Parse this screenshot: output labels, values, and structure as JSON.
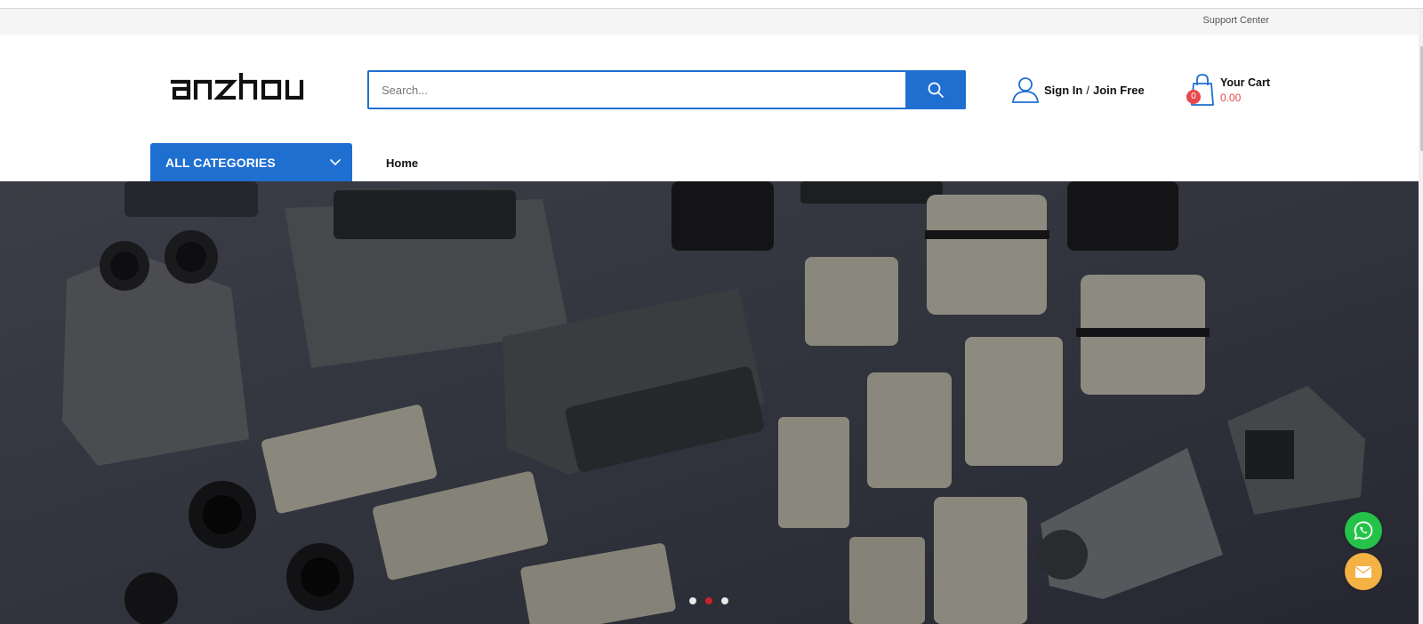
{
  "colors": {
    "accent": "#1f6fd1",
    "cart_red": "#e8484d",
    "slider_active": "#d0202a",
    "whatsapp": "#25c24a",
    "mail": "#f4b144"
  },
  "topbar": {
    "support_label": "Support Center"
  },
  "header": {
    "logo_text": "anzhou",
    "search": {
      "placeholder": "Search...",
      "value": "",
      "button_icon": "search-icon"
    },
    "account": {
      "signin_label": "Sign In",
      "separator": "/",
      "join_label": "Join Free",
      "icon": "user-icon"
    },
    "cart": {
      "title": "Your Cart",
      "total": "0.00",
      "count": "0",
      "icon": "shopping-bag-icon"
    }
  },
  "nav": {
    "categories_label": "ALL CATEGORIES",
    "categories_icon": "chevron-down-icon",
    "items": [
      {
        "label": "Home"
      }
    ]
  },
  "hero": {
    "description": "",
    "slides": 3,
    "active_slide": 2
  },
  "floating": [
    {
      "name": "whatsapp",
      "icon": "whatsapp-icon"
    },
    {
      "name": "email",
      "icon": "mail-icon"
    }
  ]
}
